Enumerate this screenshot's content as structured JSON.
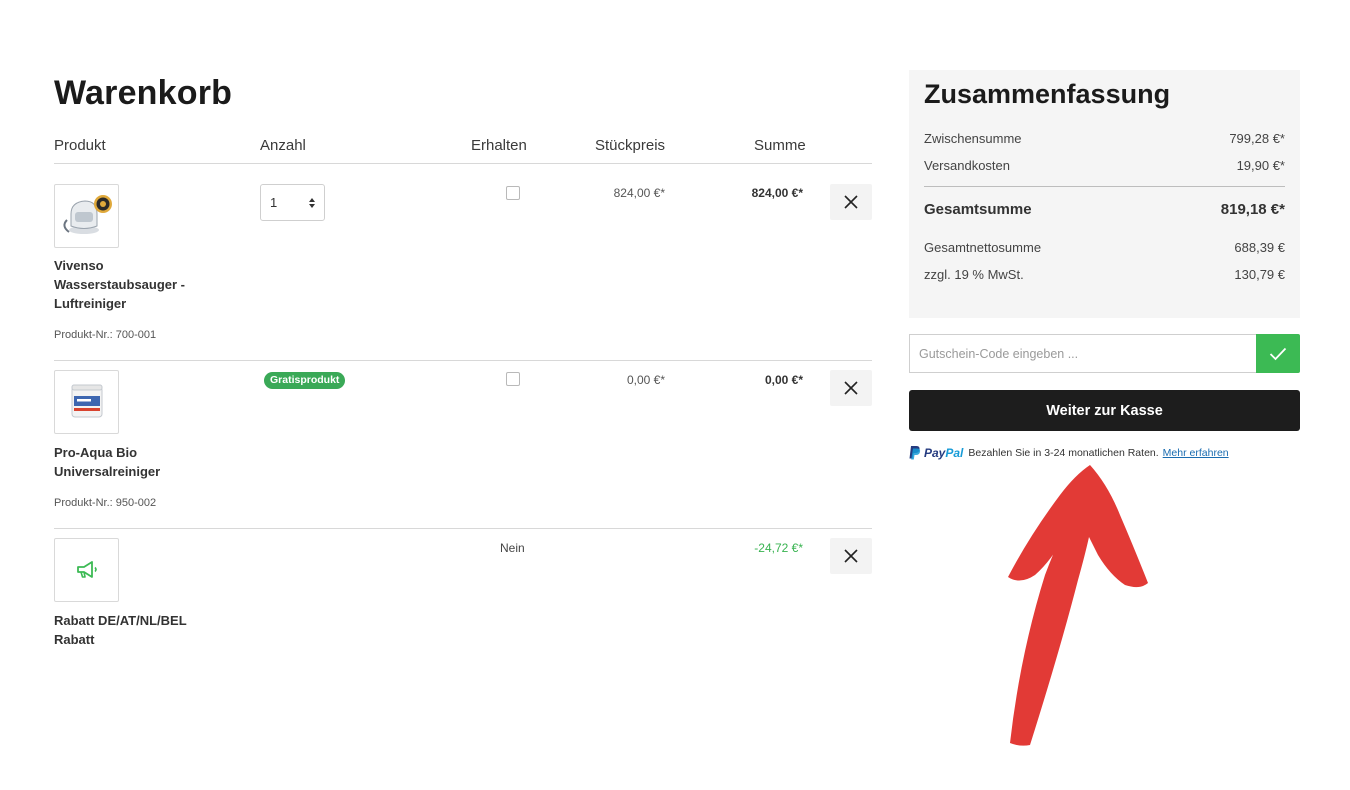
{
  "cart": {
    "title": "Warenkorb",
    "columns": {
      "product": "Produkt",
      "quantity": "Anzahl",
      "received": "Erhalten",
      "unit_price": "Stückpreis",
      "total": "Summe"
    },
    "items": [
      {
        "name": "Vivenso Wasserstaubsauger - Luftreiniger",
        "product_no": "Produkt-Nr.: 700-001",
        "quantity": "1",
        "unit_price": "824,00 €*",
        "total": "824,00 €*",
        "image_icon": "vacuum-cleaner-product-image"
      },
      {
        "name": "Pro-Aqua Bio Universalreiniger",
        "product_no": "Produkt-Nr.: 950-002",
        "badge": "Gratisprodukt",
        "unit_price": "0,00 €*",
        "total": "0,00 €*",
        "image_icon": "cleaner-tub-product-image"
      },
      {
        "name": "Rabatt DE/AT/NL/BEL Rabatt",
        "received": "Nein",
        "total": "-24,72 €*",
        "image_icon": "megaphone-icon"
      }
    ],
    "remove_icon": "close-icon"
  },
  "summary": {
    "title": "Zusammenfassung",
    "subtotal_label": "Zwischensumme",
    "subtotal_value": "799,28 €*",
    "shipping_label": "Versandkosten",
    "shipping_value": "19,90 €*",
    "grand_total_label": "Gesamtsumme",
    "grand_total_value": "819,18 €*",
    "net_total_label": "Gesamtnettosumme",
    "net_total_value": "688,39 €",
    "vat_label": "zzgl. 19 % MwSt.",
    "vat_value": "130,79 €"
  },
  "coupon": {
    "placeholder": "Gutschein-Code eingeben ...",
    "submit_icon": "checkmark-icon"
  },
  "checkout": {
    "button_label": "Weiter zur Kasse"
  },
  "paypal": {
    "logo_text_1": "Pay",
    "logo_text_2": "Pal",
    "message": "Bezahlen Sie in 3-24 monatlichen Raten.",
    "link": "Mehr erfahren"
  },
  "colors": {
    "accent_green": "#3cba54",
    "checkout_bg": "#1d1d1d",
    "annotation_red": "#e23a36"
  }
}
